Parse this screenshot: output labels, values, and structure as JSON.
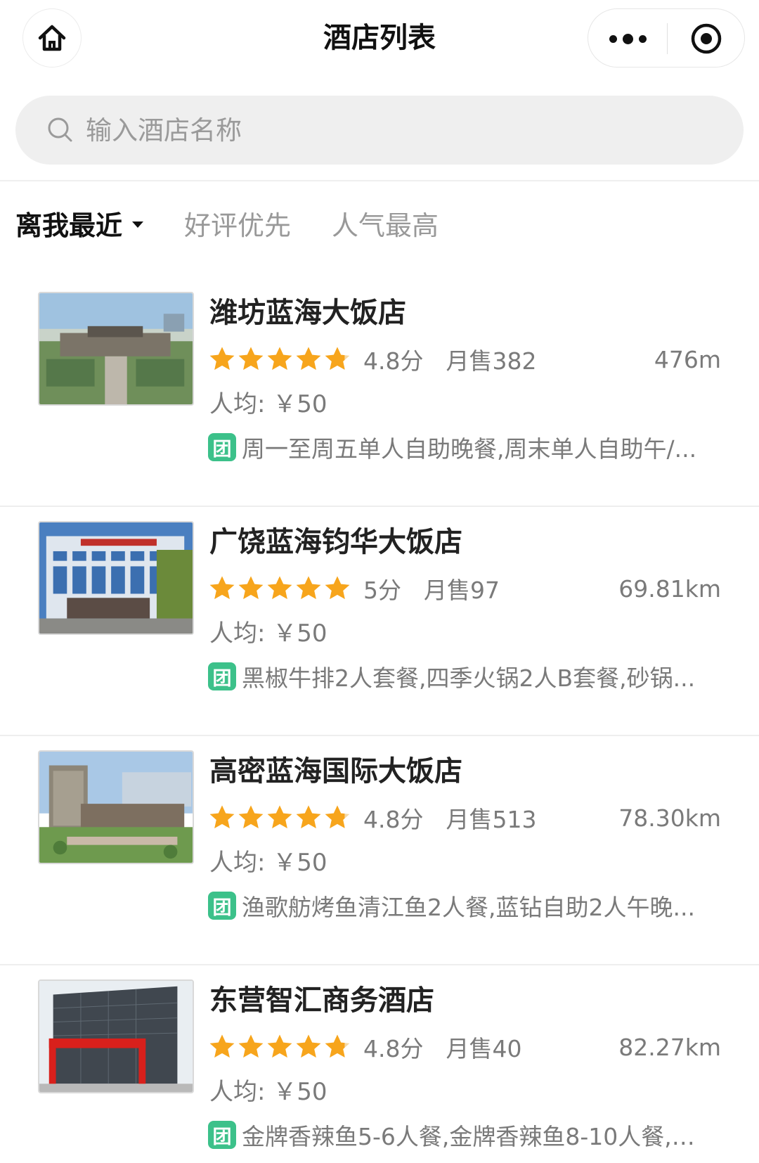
{
  "header": {
    "title": "酒店列表",
    "home_icon": "home-icon",
    "more_icon": "more-dots-icon",
    "target_icon": "target-icon"
  },
  "search": {
    "placeholder": "输入酒店名称",
    "icon": "search-icon"
  },
  "sort_tabs": [
    {
      "label": "离我最近",
      "active": true
    },
    {
      "label": "好评优先",
      "active": false
    },
    {
      "label": "人气最高",
      "active": false
    }
  ],
  "colors": {
    "star": "#f7a51c",
    "badge": "#3cc18a",
    "muted_text": "#7a7a7a"
  },
  "hotels": [
    {
      "name": "潍坊蓝海大饭店",
      "rating": 4.8,
      "score": "4.8分",
      "sales": "月售382",
      "distance": "476m",
      "avg_price": "人均: ￥50",
      "deal_badge": "团",
      "deal": "周一至周五单人自助晚餐,周末单人自助午/..."
    },
    {
      "name": "广饶蓝海钧华大饭店",
      "rating": 5,
      "score": "5分",
      "sales": "月售97",
      "distance": "69.81km",
      "avg_price": "人均: ￥50",
      "deal_badge": "团",
      "deal": "黑椒牛排2人套餐,四季火锅2人B套餐,砂锅..."
    },
    {
      "name": "高密蓝海国际大饭店",
      "rating": 4.8,
      "score": "4.8分",
      "sales": "月售513",
      "distance": "78.30km",
      "avg_price": "人均: ￥50",
      "deal_badge": "团",
      "deal": "渔歌舫烤鱼清江鱼2人餐,蓝钻自助2人午晚..."
    },
    {
      "name": "东营智汇商务酒店",
      "rating": 4.8,
      "score": "4.8分",
      "sales": "月售40",
      "distance": "82.27km",
      "avg_price": "人均: ￥50",
      "deal_badge": "团",
      "deal": "金牌香辣鱼5-6人餐,金牌香辣鱼8-10人餐,炒..."
    }
  ]
}
